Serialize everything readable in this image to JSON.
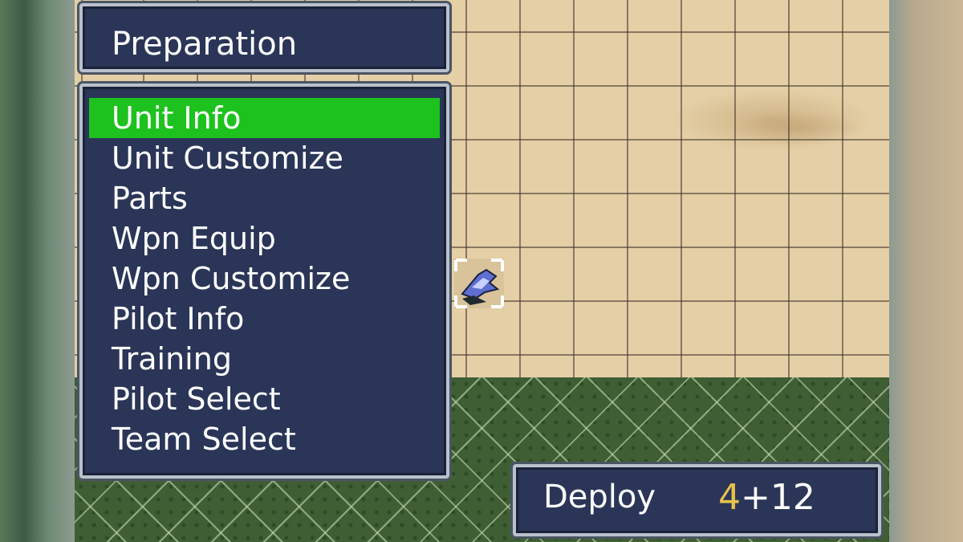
{
  "colors": {
    "panel_bg": "#2a3558",
    "selection_bg": "#1ec21e",
    "highlight_number": "#e8c24a",
    "text": "#ffffff"
  },
  "header": {
    "title": "Preparation"
  },
  "menu": {
    "selected_index": 0,
    "items": [
      {
        "label": "Unit Info"
      },
      {
        "label": "Unit Customize"
      },
      {
        "label": "Parts"
      },
      {
        "label": "Wpn Equip"
      },
      {
        "label": "Wpn Customize"
      },
      {
        "label": "Pilot Info"
      },
      {
        "label": "Training"
      },
      {
        "label": "Pilot Select"
      },
      {
        "label": "Team Select"
      }
    ]
  },
  "deploy": {
    "label": "Deploy",
    "count_first": "4",
    "count_rest": "+12"
  },
  "map": {
    "unit_icon": "mech-unit-icon",
    "terrain": [
      "sand",
      "grass"
    ]
  }
}
